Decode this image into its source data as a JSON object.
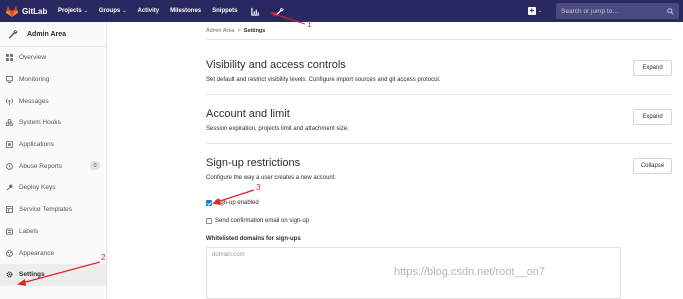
{
  "topbar": {
    "brand": "GitLab",
    "nav": [
      {
        "label": "Projects",
        "caret": "⌄"
      },
      {
        "label": "Groups",
        "caret": "⌄"
      },
      {
        "label": "Activity",
        "caret": ""
      },
      {
        "label": "Milestones",
        "caret": ""
      },
      {
        "label": "Snippets",
        "caret": ""
      }
    ],
    "icons": [
      "chart-icon",
      "wrench-icon"
    ],
    "plus_caret": "⌄",
    "search_placeholder": "Search or jump to…",
    "bg_color": "#292961"
  },
  "sidebar": {
    "title": "Admin Area",
    "items": [
      {
        "label": "Overview",
        "icon": "grid-icon"
      },
      {
        "label": "Monitoring",
        "icon": "monitor-icon"
      },
      {
        "label": "Messages",
        "icon": "broadcast-icon"
      },
      {
        "label": "System Hooks",
        "icon": "hook-icon"
      },
      {
        "label": "Applications",
        "icon": "apps-icon"
      },
      {
        "label": "Abuse Reports",
        "icon": "alert-icon",
        "badge": "0"
      },
      {
        "label": "Deploy Keys",
        "icon": "key-icon"
      },
      {
        "label": "Service Templates",
        "icon": "template-icon"
      },
      {
        "label": "Labels",
        "icon": "label-icon"
      },
      {
        "label": "Appearance",
        "icon": "palette-icon"
      },
      {
        "label": "Settings",
        "icon": "gear-icon",
        "active": true
      }
    ]
  },
  "breadcrumb": {
    "parent": "Admin Area",
    "sep": ">",
    "current": "Settings"
  },
  "sections": [
    {
      "title": "Visibility and access controls",
      "desc": "Set default and restrict visibility levels. Configure import sources and git access protocol.",
      "button": "Expand"
    },
    {
      "title": "Account and limit",
      "desc": "Session expiration, projects limit and attachment size.",
      "button": "Expand"
    },
    {
      "title": "Sign-up restrictions",
      "desc": "Configure the way a user creates a new account.",
      "button": "Collapse"
    }
  ],
  "signup": {
    "signup_enabled": {
      "label": "Sign-up enabled",
      "checked": true
    },
    "confirm_email": {
      "label": "Send confirmation email on sign-up",
      "checked": false
    },
    "whitelist_label": "Whitelisted domains for sign-ups",
    "whitelist_placeholder": "domain.com"
  },
  "annotations": [
    "1",
    "2",
    "3"
  ],
  "watermark": "https://blog.csdn.net/root__oo7",
  "colors": {
    "accent": "#1f78d1",
    "annotation": "#e0262b"
  }
}
